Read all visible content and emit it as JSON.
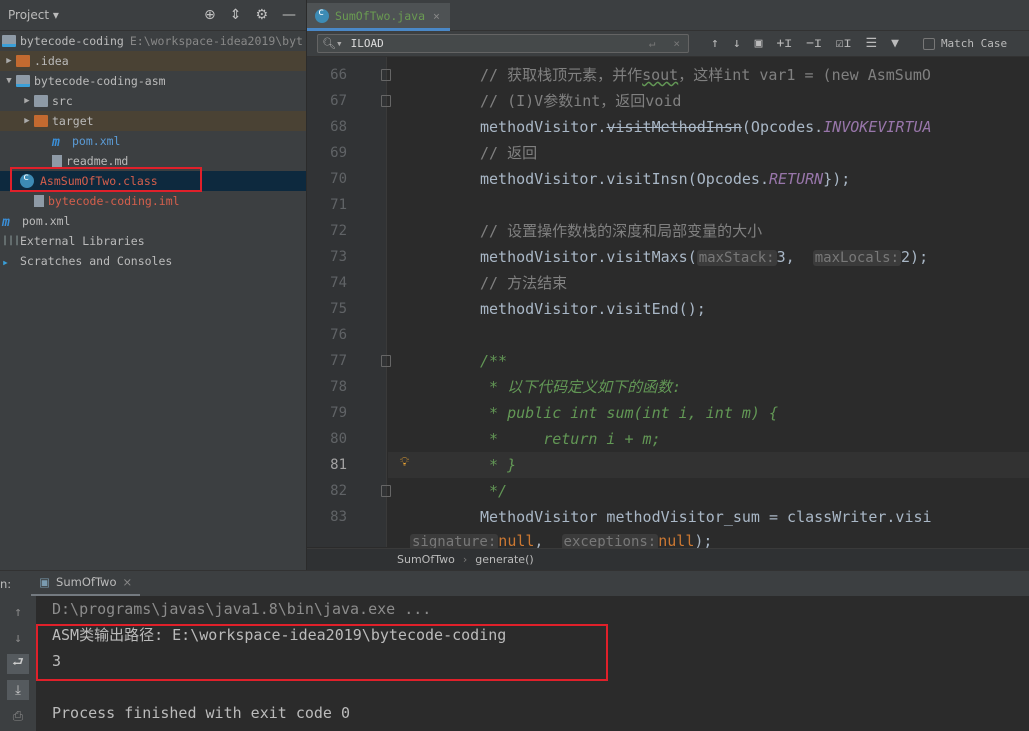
{
  "project_panel": {
    "title": "Project",
    "tree": [
      {
        "label": "bytecode-coding",
        "path": "E:\\workspace-idea2019\\byt",
        "icon": "module-icon",
        "arrow": "",
        "indent": 0,
        "color": "#bbbbbb"
      },
      {
        "label": ".idea",
        "icon": "folder-icon",
        "arrow": "▶",
        "indent": 0,
        "color": "#bbbbbb",
        "highlight": true
      },
      {
        "label": "bytecode-coding-asm",
        "icon": "module-icon",
        "arrow": "▼",
        "indent": 0,
        "color": "#bbbbbb"
      },
      {
        "label": "src",
        "icon": "folder-icon",
        "arrow": "▶",
        "indent": 1,
        "color": "#bbbbbb"
      },
      {
        "label": "target",
        "icon": "folder-excluded-icon",
        "arrow": "▶",
        "indent": 1,
        "color": "#bbbbbb",
        "highlight": true
      },
      {
        "label": "pom.xml",
        "icon": "maven-icon",
        "arrow": "",
        "indent": 2,
        "color": "#5b9bd6"
      },
      {
        "label": "readme.md",
        "icon": "markdown-icon",
        "arrow": "",
        "indent": 2,
        "color": "#bbbbbb"
      },
      {
        "label": "AsmSumOfTwo.class",
        "icon": "class-icon",
        "arrow": "",
        "indent": -0.5,
        "color": "#d55f4c",
        "selected": true
      },
      {
        "label": "bytecode-coding.iml",
        "icon": "iml-icon",
        "arrow": "",
        "indent": 1,
        "color": "#d55f4c"
      },
      {
        "label": "pom.xml",
        "icon": "maven-icon",
        "arrow": "",
        "indent": 0,
        "color": "#bbbbbb"
      },
      {
        "label": "External Libraries",
        "icon": "libraries-icon",
        "arrow": "",
        "indent": -1,
        "color": "#bbbbbb"
      },
      {
        "label": "Scratches and Consoles",
        "icon": "scratches-icon",
        "arrow": "",
        "indent": -1,
        "color": "#bbbbbb"
      }
    ]
  },
  "editor": {
    "tab": "SumOfTwo.java",
    "search": {
      "value": "ILOAD",
      "match_case": "Match Case"
    },
    "current_line": 81,
    "lines": [
      {
        "n": 66,
        "segs": [
          [
            "c-cm",
            "// 获取栈顶元素，并作"
          ],
          [
            "c-cm wavy",
            "sout"
          ],
          [
            "c-cm",
            "，这样int var1 = (new AsmSumO"
          ]
        ]
      },
      {
        "n": 67,
        "segs": [
          [
            "c-cm",
            "// (I)V参数int，返回void"
          ]
        ]
      },
      {
        "n": 68,
        "segs": [
          [
            "",
            "methodVisitor."
          ],
          [
            "strike",
            "visitMethodInsn"
          ],
          [
            "",
            "(Opcodes."
          ],
          [
            "c-st",
            "INVOKEVIRTUA"
          ]
        ]
      },
      {
        "n": 69,
        "segs": [
          [
            "c-cm",
            "// 返回"
          ]
        ]
      },
      {
        "n": 70,
        "segs": [
          [
            "",
            "methodVisitor.visitInsn(Opcodes."
          ],
          [
            "c-st",
            "RETURN"
          ],
          [
            "",
            "});"
          ]
        ]
      },
      {
        "n": 71,
        "segs": []
      },
      {
        "n": 72,
        "segs": [
          [
            "c-cm",
            "// 设置操作数栈的深度和局部变量的大小"
          ]
        ]
      },
      {
        "n": 73,
        "segs": [
          [
            "",
            "methodVisitor.visitMaxs("
          ],
          [
            "hint",
            "maxStack:"
          ],
          [
            "c-num",
            "3"
          ],
          [
            "",
            ",  "
          ],
          [
            "hint",
            "maxLocals:"
          ],
          [
            "",
            "2);"
          ]
        ]
      },
      {
        "n": 74,
        "segs": [
          [
            "c-cm",
            "// 方法结束"
          ]
        ]
      },
      {
        "n": 75,
        "segs": [
          [
            "",
            "methodVisitor.visitEnd();"
          ]
        ]
      },
      {
        "n": 76,
        "segs": []
      },
      {
        "n": 77,
        "segs": [
          [
            "c-doc",
            "/**"
          ]
        ]
      },
      {
        "n": 78,
        "segs": [
          [
            "c-doc",
            " * 以下代码定义如下的函数:"
          ]
        ]
      },
      {
        "n": 79,
        "segs": [
          [
            "c-doc",
            " * public int sum(int i, int m) {"
          ]
        ]
      },
      {
        "n": 80,
        "segs": [
          [
            "c-doc",
            " *     return i + m;"
          ]
        ]
      },
      {
        "n": 81,
        "segs": [
          [
            "c-doc",
            " * }"
          ]
        ]
      },
      {
        "n": 82,
        "segs": [
          [
            "c-doc",
            " */"
          ]
        ]
      },
      {
        "n": 83,
        "segs": [
          [
            "",
            "MethodVisitor methodVisitor_sum = classWriter.visi"
          ]
        ]
      }
    ],
    "wrap_line": [
      [
        "hint",
        "signature:"
      ],
      [
        "c-kw",
        "null"
      ],
      [
        "",
        ",  "
      ],
      [
        "hint",
        "exceptions:"
      ],
      [
        "c-kw",
        "null"
      ],
      [
        "",
        ");"
      ]
    ],
    "breadcrumb": [
      "SumOfTwo",
      "generate()"
    ]
  },
  "run_panel": {
    "label": "n:",
    "tab": "SumOfTwo",
    "output": [
      {
        "text": "D:\\programs\\javas\\java1.8\\bin\\java.exe ...",
        "color": "#8c8c8c"
      },
      {
        "text": "ASM类输出路径: E:\\workspace-idea2019\\bytecode-coding",
        "color": "#bbbbbb"
      },
      {
        "text": "3",
        "color": "#bbbbbb"
      },
      {
        "text": "",
        "color": "#bbbbbb"
      },
      {
        "text": "Process finished with exit code 0",
        "color": "#bbbbbb"
      }
    ]
  },
  "colors": {
    "highlight_box": "#e0202a",
    "selection": "#0d293e",
    "comment": "#808080",
    "doc_comment": "#629755",
    "keyword": "#cc7832",
    "static_field": "#9876aa"
  }
}
